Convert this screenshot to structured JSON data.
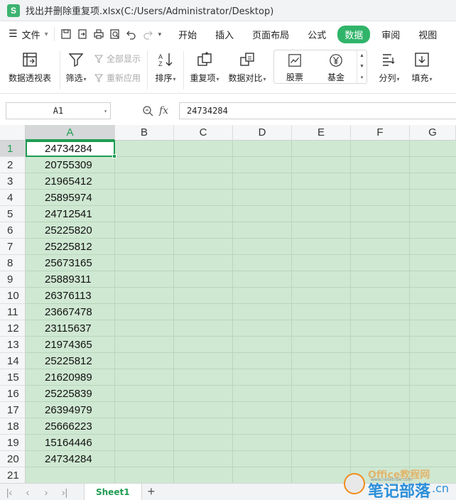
{
  "window": {
    "app_logo": "S",
    "title": "找出并删除重复项.xlsx(C:/Users/Administrator/Desktop)"
  },
  "menu": {
    "file_label": "文件",
    "tabs": [
      {
        "label": "开始",
        "active": false
      },
      {
        "label": "插入",
        "active": false
      },
      {
        "label": "页面布局",
        "active": false
      },
      {
        "label": "公式",
        "active": false
      },
      {
        "label": "数据",
        "active": true
      },
      {
        "label": "审阅",
        "active": false
      },
      {
        "label": "视图",
        "active": false
      }
    ]
  },
  "ribbon": {
    "pivot": "数据透视表",
    "filter": "筛选",
    "show_all": "全部显示",
    "reapply": "重新应用",
    "sort": "排序",
    "duplicates": "重复项",
    "compare": "数据对比",
    "stocks": "股票",
    "funds": "基金",
    "split": "分列",
    "fill": "填充"
  },
  "formula_bar": {
    "name_box": "A1",
    "fx": "fx",
    "content": "24734284"
  },
  "grid": {
    "columns": [
      "A",
      "B",
      "C",
      "D",
      "E",
      "F",
      "G"
    ],
    "selected_column": "A",
    "active_cell": "A1",
    "rows": [
      {
        "row": "1",
        "A": "24734284"
      },
      {
        "row": "2",
        "A": "20755309"
      },
      {
        "row": "3",
        "A": "21965412"
      },
      {
        "row": "4",
        "A": "25895974"
      },
      {
        "row": "5",
        "A": "24712541"
      },
      {
        "row": "6",
        "A": "25225820"
      },
      {
        "row": "7",
        "A": "25225812"
      },
      {
        "row": "8",
        "A": "25673165"
      },
      {
        "row": "9",
        "A": "25889311"
      },
      {
        "row": "10",
        "A": "26376113"
      },
      {
        "row": "11",
        "A": "23667478"
      },
      {
        "row": "12",
        "A": "23115637"
      },
      {
        "row": "13",
        "A": "21974365"
      },
      {
        "row": "14",
        "A": "25225812"
      },
      {
        "row": "15",
        "A": "21620989"
      },
      {
        "row": "16",
        "A": "25225839"
      },
      {
        "row": "17",
        "A": "26394979"
      },
      {
        "row": "18",
        "A": "25666223"
      },
      {
        "row": "19",
        "A": "15164446"
      },
      {
        "row": "20",
        "A": "24734284"
      },
      {
        "row": "21",
        "A": ""
      }
    ]
  },
  "sheets": {
    "active": "Sheet1"
  },
  "watermark": {
    "line1": "Office教程网",
    "line2": "笔记部落",
    "line3": ".cn",
    "url": "www.notetribe.com"
  },
  "colors": {
    "accent": "#1e9c52",
    "selection_fill": "#cfe8d2",
    "tab_active": "#30b46a"
  }
}
